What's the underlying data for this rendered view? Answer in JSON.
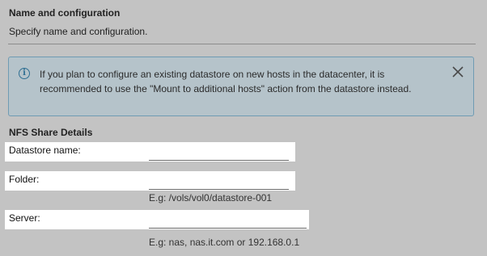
{
  "header": {
    "title": "Name and configuration",
    "subtitle": "Specify name and configuration."
  },
  "info_banner": {
    "icon": "info-icon",
    "text": "If you plan to configure an existing datastore on new hosts in the datacenter, it is recommended to use the \"Mount to additional hosts\" action from the datastore instead.",
    "close_icon": "close-icon"
  },
  "nfs": {
    "title": "NFS Share Details",
    "fields": {
      "datastore_name": {
        "label": "Datastore name:",
        "value": ""
      },
      "folder": {
        "label": "Folder:",
        "value": "",
        "hint": "E.g: /vols/vol0/datastore-001"
      },
      "server": {
        "label": "Server:",
        "value": "",
        "hint": "E.g: nas, nas.it.com or 192.168.0.1"
      }
    }
  }
}
